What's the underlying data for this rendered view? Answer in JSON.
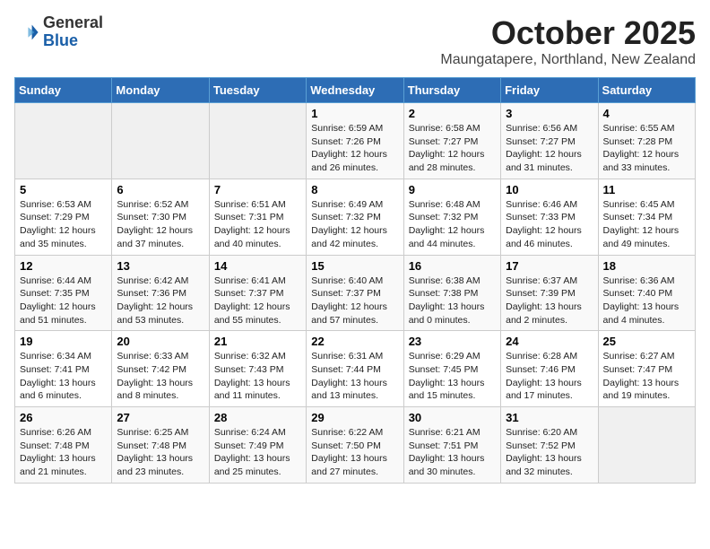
{
  "logo": {
    "general": "General",
    "blue": "Blue"
  },
  "title": "October 2025",
  "location": "Maungatapere, Northland, New Zealand",
  "weekdays": [
    "Sunday",
    "Monday",
    "Tuesday",
    "Wednesday",
    "Thursday",
    "Friday",
    "Saturday"
  ],
  "weeks": [
    [
      {
        "day": "",
        "content": ""
      },
      {
        "day": "",
        "content": ""
      },
      {
        "day": "",
        "content": ""
      },
      {
        "day": "1",
        "content": "Sunrise: 6:59 AM\nSunset: 7:26 PM\nDaylight: 12 hours\nand 26 minutes."
      },
      {
        "day": "2",
        "content": "Sunrise: 6:58 AM\nSunset: 7:27 PM\nDaylight: 12 hours\nand 28 minutes."
      },
      {
        "day": "3",
        "content": "Sunrise: 6:56 AM\nSunset: 7:27 PM\nDaylight: 12 hours\nand 31 minutes."
      },
      {
        "day": "4",
        "content": "Sunrise: 6:55 AM\nSunset: 7:28 PM\nDaylight: 12 hours\nand 33 minutes."
      }
    ],
    [
      {
        "day": "5",
        "content": "Sunrise: 6:53 AM\nSunset: 7:29 PM\nDaylight: 12 hours\nand 35 minutes."
      },
      {
        "day": "6",
        "content": "Sunrise: 6:52 AM\nSunset: 7:30 PM\nDaylight: 12 hours\nand 37 minutes."
      },
      {
        "day": "7",
        "content": "Sunrise: 6:51 AM\nSunset: 7:31 PM\nDaylight: 12 hours\nand 40 minutes."
      },
      {
        "day": "8",
        "content": "Sunrise: 6:49 AM\nSunset: 7:32 PM\nDaylight: 12 hours\nand 42 minutes."
      },
      {
        "day": "9",
        "content": "Sunrise: 6:48 AM\nSunset: 7:32 PM\nDaylight: 12 hours\nand 44 minutes."
      },
      {
        "day": "10",
        "content": "Sunrise: 6:46 AM\nSunset: 7:33 PM\nDaylight: 12 hours\nand 46 minutes."
      },
      {
        "day": "11",
        "content": "Sunrise: 6:45 AM\nSunset: 7:34 PM\nDaylight: 12 hours\nand 49 minutes."
      }
    ],
    [
      {
        "day": "12",
        "content": "Sunrise: 6:44 AM\nSunset: 7:35 PM\nDaylight: 12 hours\nand 51 minutes."
      },
      {
        "day": "13",
        "content": "Sunrise: 6:42 AM\nSunset: 7:36 PM\nDaylight: 12 hours\nand 53 minutes."
      },
      {
        "day": "14",
        "content": "Sunrise: 6:41 AM\nSunset: 7:37 PM\nDaylight: 12 hours\nand 55 minutes."
      },
      {
        "day": "15",
        "content": "Sunrise: 6:40 AM\nSunset: 7:37 PM\nDaylight: 12 hours\nand 57 minutes."
      },
      {
        "day": "16",
        "content": "Sunrise: 6:38 AM\nSunset: 7:38 PM\nDaylight: 13 hours\nand 0 minutes."
      },
      {
        "day": "17",
        "content": "Sunrise: 6:37 AM\nSunset: 7:39 PM\nDaylight: 13 hours\nand 2 minutes."
      },
      {
        "day": "18",
        "content": "Sunrise: 6:36 AM\nSunset: 7:40 PM\nDaylight: 13 hours\nand 4 minutes."
      }
    ],
    [
      {
        "day": "19",
        "content": "Sunrise: 6:34 AM\nSunset: 7:41 PM\nDaylight: 13 hours\nand 6 minutes."
      },
      {
        "day": "20",
        "content": "Sunrise: 6:33 AM\nSunset: 7:42 PM\nDaylight: 13 hours\nand 8 minutes."
      },
      {
        "day": "21",
        "content": "Sunrise: 6:32 AM\nSunset: 7:43 PM\nDaylight: 13 hours\nand 11 minutes."
      },
      {
        "day": "22",
        "content": "Sunrise: 6:31 AM\nSunset: 7:44 PM\nDaylight: 13 hours\nand 13 minutes."
      },
      {
        "day": "23",
        "content": "Sunrise: 6:29 AM\nSunset: 7:45 PM\nDaylight: 13 hours\nand 15 minutes."
      },
      {
        "day": "24",
        "content": "Sunrise: 6:28 AM\nSunset: 7:46 PM\nDaylight: 13 hours\nand 17 minutes."
      },
      {
        "day": "25",
        "content": "Sunrise: 6:27 AM\nSunset: 7:47 PM\nDaylight: 13 hours\nand 19 minutes."
      }
    ],
    [
      {
        "day": "26",
        "content": "Sunrise: 6:26 AM\nSunset: 7:48 PM\nDaylight: 13 hours\nand 21 minutes."
      },
      {
        "day": "27",
        "content": "Sunrise: 6:25 AM\nSunset: 7:48 PM\nDaylight: 13 hours\nand 23 minutes."
      },
      {
        "day": "28",
        "content": "Sunrise: 6:24 AM\nSunset: 7:49 PM\nDaylight: 13 hours\nand 25 minutes."
      },
      {
        "day": "29",
        "content": "Sunrise: 6:22 AM\nSunset: 7:50 PM\nDaylight: 13 hours\nand 27 minutes."
      },
      {
        "day": "30",
        "content": "Sunrise: 6:21 AM\nSunset: 7:51 PM\nDaylight: 13 hours\nand 30 minutes."
      },
      {
        "day": "31",
        "content": "Sunrise: 6:20 AM\nSunset: 7:52 PM\nDaylight: 13 hours\nand 32 minutes."
      },
      {
        "day": "",
        "content": ""
      }
    ]
  ]
}
